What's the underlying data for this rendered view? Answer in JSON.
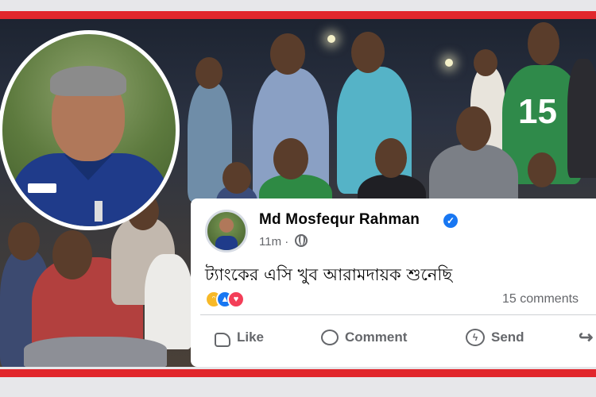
{
  "post": {
    "author": "Md Mosfequr Rahman",
    "verified_icon": "verified-check-icon",
    "time": "11m",
    "privacy_icon": "globe-icon",
    "text": "ট্যাংকের এসি খুব আরামদায়ক শুনেছি",
    "reactions": [
      "haha",
      "like",
      "love"
    ],
    "comments_count": "15 comments"
  },
  "actions": {
    "like_label": "Like",
    "comment_label": "Comment",
    "send_label": "Send"
  },
  "photo": {
    "jersey_number": "15"
  },
  "colors": {
    "accent_red": "#e1262c",
    "facebook_blue": "#1877f2",
    "text_secondary": "#65676b"
  }
}
